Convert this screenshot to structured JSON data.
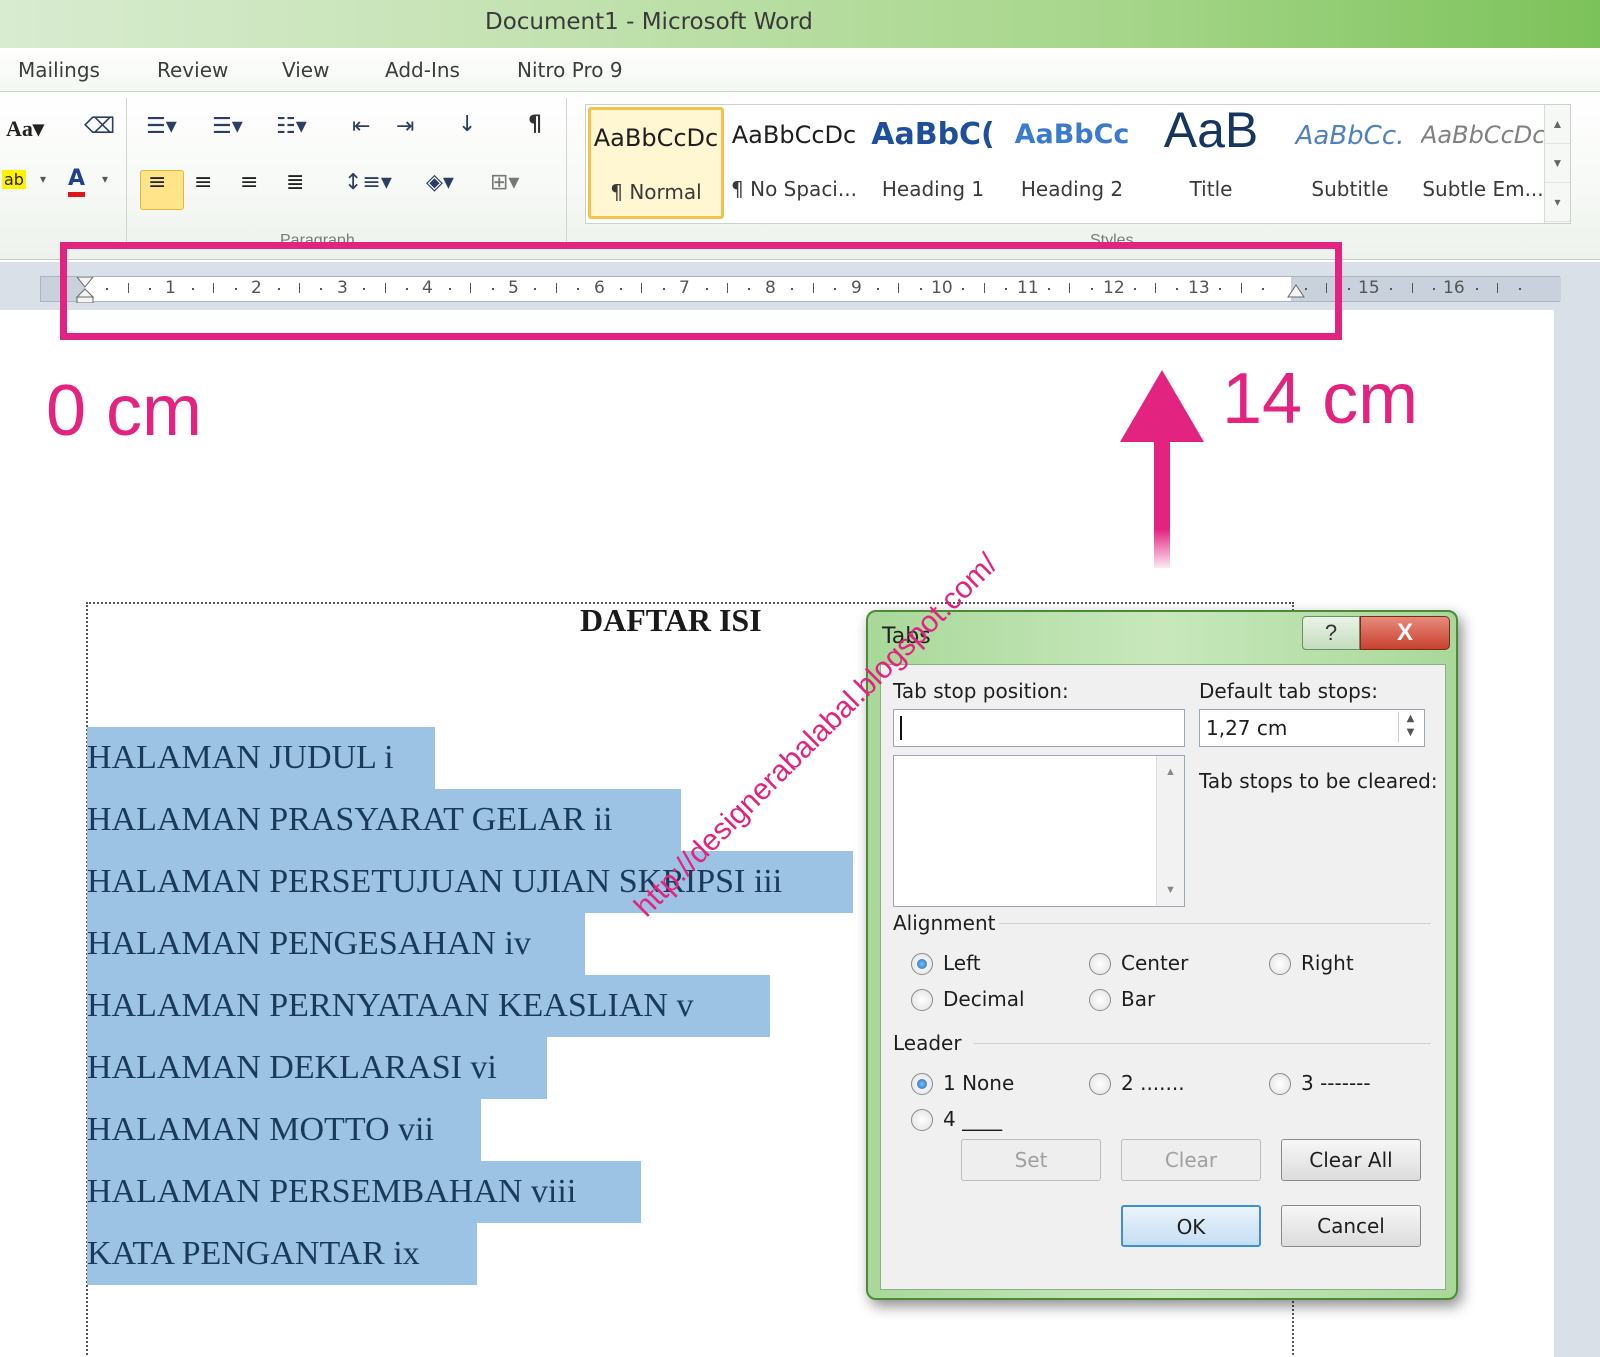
{
  "window": {
    "title": "Document1  -  Microsoft Word"
  },
  "menu": {
    "tabs": [
      "Mailings",
      "Review",
      "View",
      "Add-Ins",
      "Nitro Pro 9"
    ]
  },
  "ribbon": {
    "font_group": {
      "change_case": "Aa",
      "highlight": "ab",
      "font_color": "A"
    },
    "paragraph_group_label": "Paragraph",
    "styles_group_label": "Styles",
    "styles": [
      {
        "sample": "AaBbCcDc",
        "label": "¶ Normal",
        "color": "#1e1e1e",
        "selected": true
      },
      {
        "sample": "AaBbCcDc",
        "label": "¶ No Spaci...",
        "color": "#1e1e1e",
        "selected": false
      },
      {
        "sample": "AaBbC(",
        "label": "Heading 1",
        "color": "#1f4e9a",
        "selected": false
      },
      {
        "sample": "AaBbCc",
        "label": "Heading 2",
        "color": "#3a7bd0",
        "selected": false
      },
      {
        "sample": "AaB",
        "label": "Title",
        "color": "#17365d",
        "selected": false
      },
      {
        "sample": "AaBbCc.",
        "label": "Subtitle",
        "color": "#4f81bd",
        "selected": false
      },
      {
        "sample": "AaBbCcDc",
        "label": "Subtle Em...",
        "color": "#808080",
        "selected": false
      }
    ]
  },
  "ruler": {
    "numbers": [
      "1",
      "2",
      "3",
      "4",
      "5",
      "6",
      "7",
      "8",
      "9",
      "10",
      "11",
      "12",
      "13",
      "15",
      "16"
    ]
  },
  "annotations": {
    "left_label": "0 cm",
    "right_label": "14 cm",
    "accent": "#e2237f"
  },
  "document": {
    "heading": "DAFTAR ISI",
    "toc_lines": [
      "HALAMAN JUDUL i",
      "HALAMAN PRASYARAT GELAR ii",
      "HALAMAN PERSETUJUAN UJIAN SKRIPSI iii",
      "HALAMAN PENGESAHAN iv",
      "HALAMAN PERNYATAAN KEASLIAN v",
      "HALAMAN DEKLARASI vi",
      "HALAMAN MOTTO vii",
      "HALAMAN PERSEMBAHAN  viii",
      "KATA PENGANTAR ix"
    ],
    "watermark": "http://designerabalabal.blogspot.com/"
  },
  "dialog": {
    "title": "Tabs",
    "help": "?",
    "close": "X",
    "tab_stop_label": "Tab stop position:",
    "tab_stop_value": "",
    "default_tab_label": "Default tab stops:",
    "default_tab_value": "1,27 cm",
    "cleared_label": "Tab stops to be cleared:",
    "alignment_label": "Alignment",
    "alignment": [
      "Left",
      "Center",
      "Right",
      "Decimal",
      "Bar"
    ],
    "alignment_selected": "Left",
    "leader_label": "Leader",
    "leader": [
      "1 None",
      "2 .......",
      "3 -------",
      "4 ____"
    ],
    "leader_selected": "1 None",
    "buttons": {
      "set": "Set",
      "clear": "Clear",
      "clear_all": "Clear All",
      "ok": "OK",
      "cancel": "Cancel"
    }
  }
}
